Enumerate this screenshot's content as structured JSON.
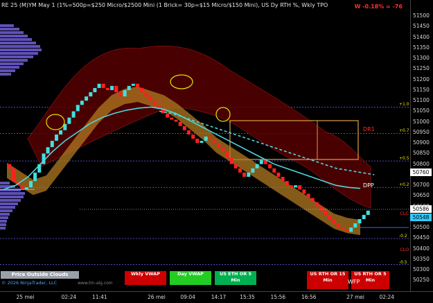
{
  "window": {
    "title": "RE 25 (M)YM May 1 (1%=500p=$250 Micro/$2500 Mini (1 Brick= 30p=$15 Micro/$150 Mini), US Dy RTH %, Wkly TPO",
    "pnl": "W -0.18% = -76",
    "copyright": "© 2026 NinjaTrader, LLC",
    "watermark": "www.trn-alg.com"
  },
  "chart_data": {
    "type": "line",
    "y_axis": {
      "ylim": [
        50225,
        51550
      ],
      "ticks": [
        51500,
        51450,
        51400,
        51350,
        51300,
        51250,
        51200,
        51150,
        51100,
        51050,
        51000,
        50950,
        50900,
        50850,
        50800,
        50750,
        50700,
        50650,
        50600,
        50550,
        50500,
        50450,
        50400,
        50350,
        50300,
        50250
      ],
      "tick_labels": [
        "51500",
        "51450",
        "51400",
        "51350",
        "51300",
        "51250",
        "51200",
        "51150",
        "51100",
        "51050",
        "51000",
        "50950",
        "50900",
        "50850",
        "50800",
        "50750",
        "50700",
        "50650",
        "50600",
        "50550",
        "50500",
        "50450",
        "50400",
        "50350",
        "50300",
        "50250"
      ]
    },
    "x_labels": [
      {
        "text": "25 mei",
        "pos": 0.06
      },
      {
        "text": "02:24",
        "pos": 0.17
      },
      {
        "text": "11:41",
        "pos": 0.245
      },
      {
        "text": "26 mei",
        "pos": 0.38
      },
      {
        "text": "09:04",
        "pos": 0.46
      },
      {
        "text": "14:17",
        "pos": 0.535
      },
      {
        "text": "15:35",
        "pos": 0.605
      },
      {
        "text": "15:56",
        "pos": 0.68
      },
      {
        "text": "16:56",
        "pos": 0.755
      },
      {
        "text": "27 mei",
        "pos": 0.865
      },
      {
        "text": "02:24",
        "pos": 0.945
      }
    ],
    "price_tags": [
      {
        "text": "50760",
        "value": 50760,
        "color": "#ffffff"
      },
      {
        "text": "50586",
        "value": 50586,
        "color": "#ffffff"
      },
      {
        "text": "50548",
        "value": 50548,
        "color": "#33ccff"
      }
    ],
    "level_labels": [
      {
        "text": "+1.0",
        "value": 51070
      },
      {
        "text": "+0.7",
        "value": 50945
      },
      {
        "text": "+0.5",
        "value": 50815
      },
      {
        "text": "+0.2",
        "value": 50690
      },
      {
        "text": "-0.2",
        "value": 50448
      },
      {
        "text": "-0.5",
        "value": 50325
      }
    ],
    "annotations": [
      {
        "text": "DR1",
        "color": "#ff3030",
        "value": 50960,
        "pos": 0.885
      },
      {
        "text": "DPP",
        "color": "#ffffff",
        "value": 50695,
        "pos": 0.885
      },
      {
        "text": "CLC",
        "color": "#ff3030",
        "value": 50560,
        "pos": 0.975
      },
      {
        "text": "CLO",
        "color": "#ff3030",
        "value": 50390,
        "pos": 0.975
      }
    ],
    "series": [
      {
        "name": "renko",
        "color_up": "#40e0e0",
        "color_down": "#ff2020",
        "values": [
          50800,
          50780,
          50720,
          50700,
          50680,
          50690,
          50720,
          50760,
          50800,
          50850,
          50880,
          50910,
          50940,
          50960,
          50990,
          51020,
          51050,
          51080,
          51100,
          51120,
          51140,
          51160,
          51180,
          51160,
          51150,
          51170,
          51140,
          51120,
          51150,
          51170,
          51180,
          51160,
          51140,
          51120,
          51100,
          51080,
          51060,
          51040,
          51020,
          51010,
          51000,
          50980,
          50960,
          50940,
          50920,
          50900,
          50910,
          50930,
          50920,
          50900,
          50880,
          50860,
          50830,
          50800,
          50780,
          50760,
          50740,
          50760,
          50780,
          50800,
          50820,
          50800,
          50780,
          50760,
          50740,
          50720,
          50700,
          50690,
          50700,
          50680,
          50660,
          50640,
          50620,
          50600,
          50580,
          50560,
          50540,
          50520,
          50500,
          50490,
          50480,
          50500,
          50520,
          50540,
          50560,
          50580
        ]
      },
      {
        "name": "vwap-cyan",
        "color": "#4fd8e0",
        "values": [
          50680,
          50700,
          50740,
          50800,
          50860,
          50910,
          50950,
          50990,
          51020,
          51040,
          51055,
          51065,
          51070,
          51060,
          51040,
          51010,
          50980,
          50950,
          50920,
          50890,
          50860,
          50830,
          50800,
          50780,
          50760,
          50740,
          50720,
          50700,
          50690,
          50685
        ]
      },
      {
        "name": "vwap-dashed",
        "color": "#4fd8e0",
        "values": [
          51050,
          51040,
          51020,
          51000,
          50980,
          50960,
          50940,
          50920,
          50900,
          50880,
          50860,
          50840,
          50820,
          50800,
          50780,
          50770,
          50760,
          50750
        ]
      },
      {
        "name": "cloud-brown",
        "color": "#b07a20",
        "values": [
          50780,
          50740,
          50700,
          50720,
          50800,
          50880,
          50960,
          51040,
          51100,
          51130,
          51140,
          51120,
          51100,
          51060,
          51010,
          50960,
          50900,
          50860,
          50820,
          50780,
          50740,
          50700,
          50660,
          50620,
          50580,
          50540,
          50520,
          50510
        ]
      }
    ]
  },
  "buttons": {
    "price_outside_clouds": "Price Outside Clouds",
    "wkly_vwap": "Wkly VWAP",
    "day_vwap": "Day VWAP",
    "us_eth": "US ETH OR 5 Min",
    "us_rth_15": "US RTH OR 15 Min",
    "us_rth_5": "US RTH OR 5 Min",
    "wfp": "WFP"
  },
  "colors": {
    "accent": "#ff3030",
    "cyan": "#40e0e0",
    "box": "#e0a040",
    "wkly_bg": "#cc0000",
    "day_bg": "#22cc22",
    "eth_bg": "#00b050",
    "rth_bg": "#cc0000",
    "poc_btn_bg": "#9aa0a8"
  }
}
